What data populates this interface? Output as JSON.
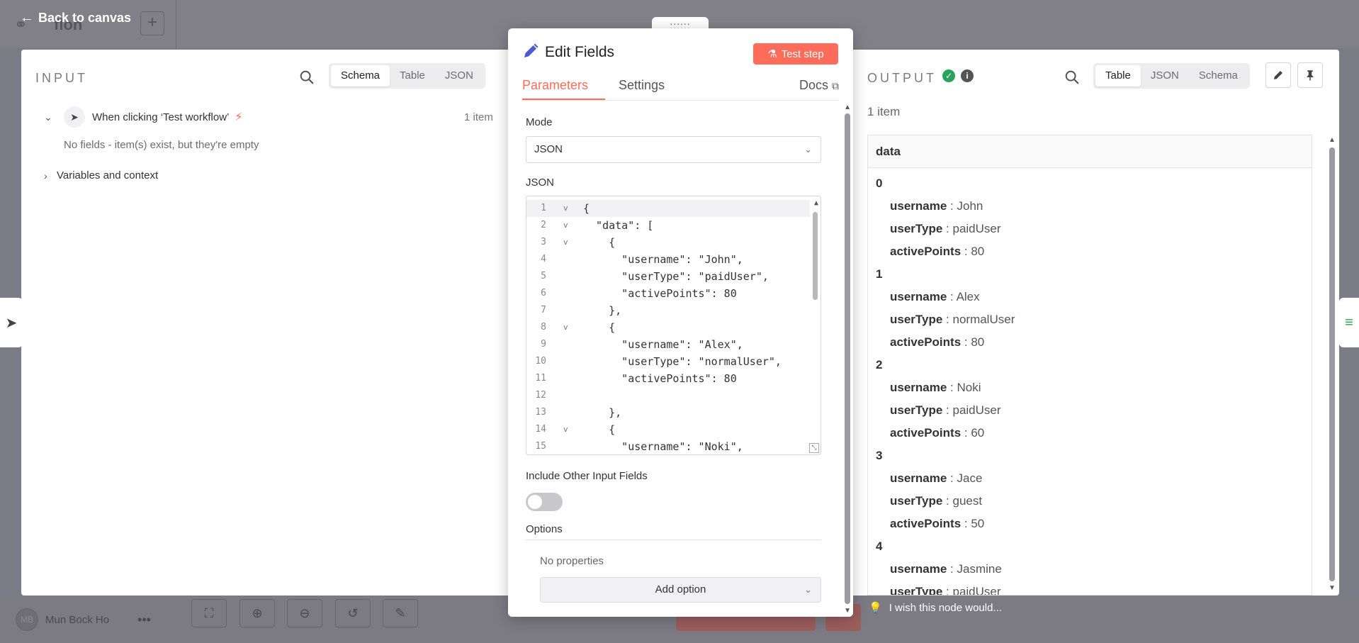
{
  "background": {
    "title": "flon",
    "user_initials": "MB",
    "user_name": "Mun Bock Ho",
    "back_label": "Back to canvas"
  },
  "input": {
    "title": "INPUT",
    "view_tabs": [
      "Schema",
      "Table",
      "JSON"
    ],
    "active_view": "Schema",
    "trigger_label": "When clicking ‘Test workflow’",
    "trigger_count": "1 item",
    "empty_message": "No fields - item(s) exist, but they're empty",
    "variables_label": "Variables and context"
  },
  "modal": {
    "title": "Edit Fields",
    "test_button": "Test step",
    "tabs": [
      "Parameters",
      "Settings"
    ],
    "active_tab": "Parameters",
    "docs_label": "Docs",
    "mode_label": "Mode",
    "mode_value": "JSON",
    "json_label": "JSON",
    "code_lines": [
      {
        "n": "1",
        "fold": true,
        "text": "{"
      },
      {
        "n": "2",
        "fold": true,
        "text": "  \"data\": ["
      },
      {
        "n": "3",
        "fold": true,
        "text": "    {"
      },
      {
        "n": "4",
        "fold": false,
        "text": "      \"username\": \"John\","
      },
      {
        "n": "5",
        "fold": false,
        "text": "      \"userType\": \"paidUser\","
      },
      {
        "n": "6",
        "fold": false,
        "text": "      \"activePoints\": 80"
      },
      {
        "n": "7",
        "fold": false,
        "text": "    },"
      },
      {
        "n": "8",
        "fold": true,
        "text": "    {"
      },
      {
        "n": "9",
        "fold": false,
        "text": "      \"username\": \"Alex\","
      },
      {
        "n": "10",
        "fold": false,
        "text": "      \"userType\": \"normalUser\","
      },
      {
        "n": "11",
        "fold": false,
        "text": "      \"activePoints\": 80"
      },
      {
        "n": "12",
        "fold": false,
        "text": ""
      },
      {
        "n": "13",
        "fold": false,
        "text": "    },"
      },
      {
        "n": "14",
        "fold": true,
        "text": "    {"
      },
      {
        "n": "15",
        "fold": false,
        "text": "      \"username\": \"Noki\","
      }
    ],
    "include_label": "Include Other Input Fields",
    "include_enabled": false,
    "options_label": "Options",
    "no_properties": "No properties",
    "add_option": "Add option"
  },
  "output": {
    "title": "OUTPUT",
    "view_tabs": [
      "Table",
      "JSON",
      "Schema"
    ],
    "active_view": "Table",
    "items_count": "1 item",
    "column": "data",
    "entries": [
      {
        "idx": "0",
        "fields": [
          [
            "username",
            "John"
          ],
          [
            "userType",
            "paidUser"
          ],
          [
            "activePoints",
            "80"
          ]
        ]
      },
      {
        "idx": "1",
        "fields": [
          [
            "username",
            "Alex"
          ],
          [
            "userType",
            "normalUser"
          ],
          [
            "activePoints",
            "80"
          ]
        ]
      },
      {
        "idx": "2",
        "fields": [
          [
            "username",
            "Noki"
          ],
          [
            "userType",
            "paidUser"
          ],
          [
            "activePoints",
            "60"
          ]
        ]
      },
      {
        "idx": "3",
        "fields": [
          [
            "username",
            "Jace"
          ],
          [
            "userType",
            "guest"
          ],
          [
            "activePoints",
            "50"
          ]
        ]
      },
      {
        "idx": "4",
        "fields": [
          [
            "username",
            "Jasmine"
          ],
          [
            "userType",
            "paidUser"
          ]
        ]
      }
    ],
    "wish_text": "I wish this node would..."
  },
  "colors": {
    "accent": "#ff6d5a",
    "success": "#2aa35a"
  }
}
